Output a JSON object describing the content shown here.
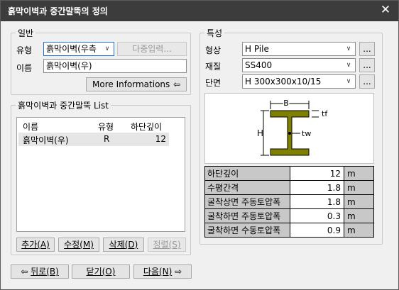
{
  "window": {
    "title": "흙막이벽과 중간말뚝의 정의",
    "close_glyph": "✕"
  },
  "general": {
    "legend": "일반",
    "type_label": "유형",
    "type_value": "흙막이벽(우측",
    "multi_input_label": "다중입력...",
    "name_label": "이름",
    "name_value": "흙막이벽(우)",
    "more_info_label": "More Informations"
  },
  "list_group": {
    "legend": "흙막이벽과 중간말뚝 List",
    "columns": [
      "이름",
      "유형",
      "하단깊이"
    ],
    "rows": [
      {
        "name": "흙막이벽(우)",
        "type": "R",
        "depth": "12"
      }
    ],
    "add_label": "추가(A)",
    "edit_label": "수정(M)",
    "delete_label": "삭제(D)",
    "sort_label": "정렬(S)"
  },
  "props": {
    "legend": "특성",
    "shape_label": "형상",
    "shape_value": "H Pile",
    "material_label": "재질",
    "material_value": "SS400",
    "section_label": "단면",
    "section_value": "H 300x300x10/15",
    "more_glyph": "...",
    "diagram": {
      "B": "B",
      "H": "H",
      "tf": "tf",
      "tw": "tw"
    },
    "table": [
      {
        "name": "하단깊이",
        "value": "12",
        "unit": "m"
      },
      {
        "name": "수평간격",
        "value": "1.8",
        "unit": "m"
      },
      {
        "name": "굴착상면 주동토압폭",
        "value": "1.8",
        "unit": "m"
      },
      {
        "name": "굴착하면 주동토압폭",
        "value": "0.3",
        "unit": "m"
      },
      {
        "name": "굴착하면 수동토압폭",
        "value": "0.9",
        "unit": "m"
      }
    ]
  },
  "footer": {
    "back_label": "뒤로(B)",
    "close_label": "닫기(O)",
    "next_label": "다음(N)"
  },
  "colors": {
    "title_bg": "#3c3c3c",
    "beam_fill": "#808000",
    "accent": "#1e6fd9"
  }
}
